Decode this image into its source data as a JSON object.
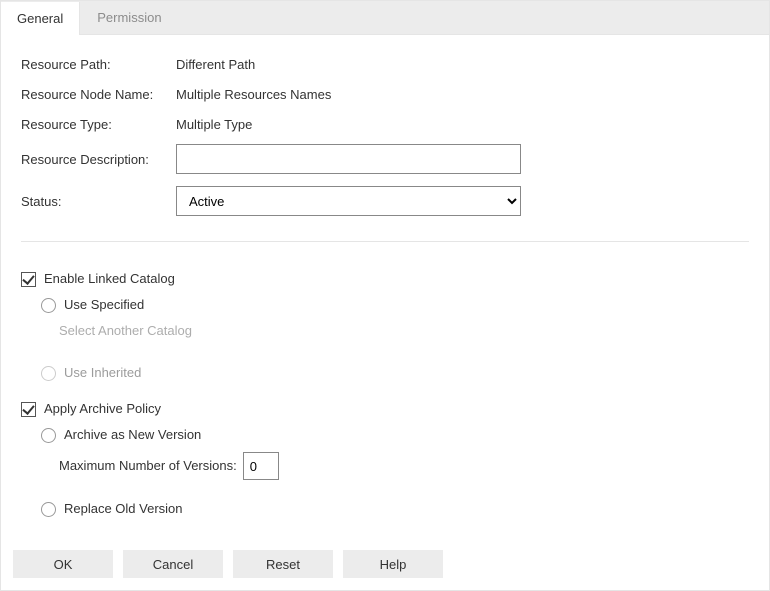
{
  "tabs": {
    "general": "General",
    "permission": "Permission",
    "active": "general"
  },
  "labels": {
    "resource_path": "Resource Path:",
    "resource_node_name": "Resource Node Name:",
    "resource_type": "Resource Type:",
    "resource_description": "Resource Description:",
    "status": "Status:"
  },
  "values": {
    "resource_path": "Different Path",
    "resource_node_name": "Multiple Resources Names",
    "resource_type": "Multiple Type",
    "resource_description": ""
  },
  "status": {
    "selected": "Active",
    "options": [
      "Active"
    ]
  },
  "linked_catalog": {
    "enable_label": "Enable Linked Catalog",
    "enable_checked": true,
    "use_specified_label": "Use Specified",
    "select_another_label": "Select Another Catalog",
    "use_inherited_label": "Use Inherited"
  },
  "archive": {
    "apply_label": "Apply Archive Policy",
    "apply_checked": true,
    "archive_new_label": "Archive as New Version",
    "max_versions_label": "Maximum Number of Versions:",
    "max_versions_value": "0",
    "replace_old_label": "Replace Old Version"
  },
  "buttons": {
    "ok": "OK",
    "cancel": "Cancel",
    "reset": "Reset",
    "help": "Help"
  }
}
